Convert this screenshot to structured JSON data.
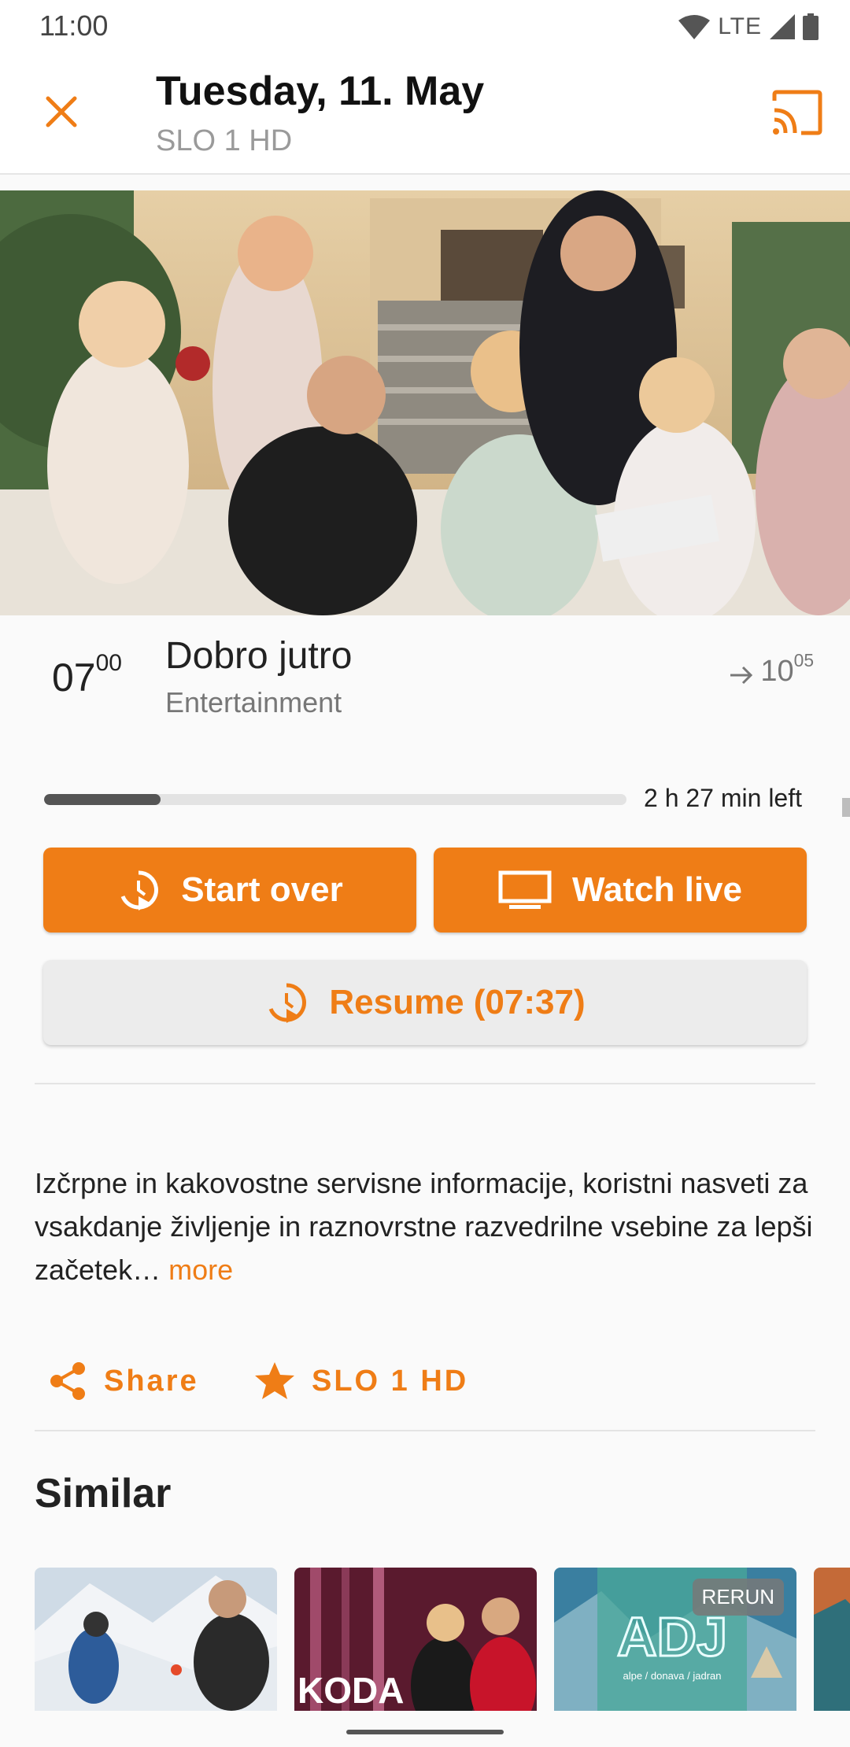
{
  "status_bar": {
    "time": "11:00",
    "network": "LTE"
  },
  "header": {
    "title": "Tuesday, 11. May",
    "channel": "SLO 1 HD"
  },
  "program": {
    "start_hour": "07",
    "start_min": "00",
    "title": "Dobro jutro",
    "genre": "Entertainment",
    "end_hour": "10",
    "end_min": "05",
    "time_left": "2 h 27 min left",
    "progress": 0.2
  },
  "buttons": {
    "start_over": "Start over",
    "watch_live": "Watch live",
    "resume": "Resume (07:37)"
  },
  "description": {
    "text": "Izčrpne in kakovostne servisne informacije, koristni nasveti za vsakdanje življenje in raznovrstne razvedrilne vsebine za lepši začetek…",
    "more": "more"
  },
  "actions": {
    "share": "Share",
    "channel": "SLO 1 HD"
  },
  "similar": {
    "title": "Similar",
    "items": [
      {
        "label": ""
      },
      {
        "label": "KODA"
      },
      {
        "title_text": "ADJ",
        "subtitle_text": "alpe / donava / jadran",
        "badge": "RERUN"
      },
      {
        "label": ""
      }
    ]
  },
  "colors": {
    "accent": "#ef7d16",
    "progress": "#555555"
  }
}
